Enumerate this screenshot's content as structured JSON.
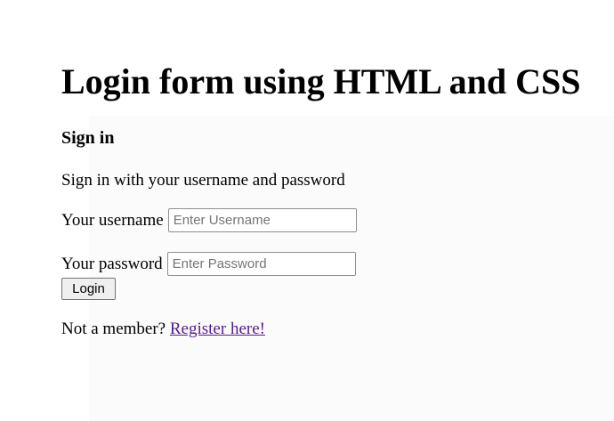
{
  "page": {
    "title": "Login form using HTML and CSS"
  },
  "form": {
    "heading": "Sign in",
    "intro": "Sign in with your username and password",
    "username_label": "Your username",
    "username_placeholder": "Enter Username",
    "username_value": "",
    "password_label": "Your password",
    "password_placeholder": "Enter Password",
    "password_value": "",
    "login_label": "Login"
  },
  "footer": {
    "prompt": "Not a member?",
    "register_link": "Register here!"
  },
  "colors": {
    "background": "#ffffff",
    "text": "#000000",
    "visited_link": "#551a8b",
    "placeholder": "#757575",
    "button_background": "#efefef"
  }
}
